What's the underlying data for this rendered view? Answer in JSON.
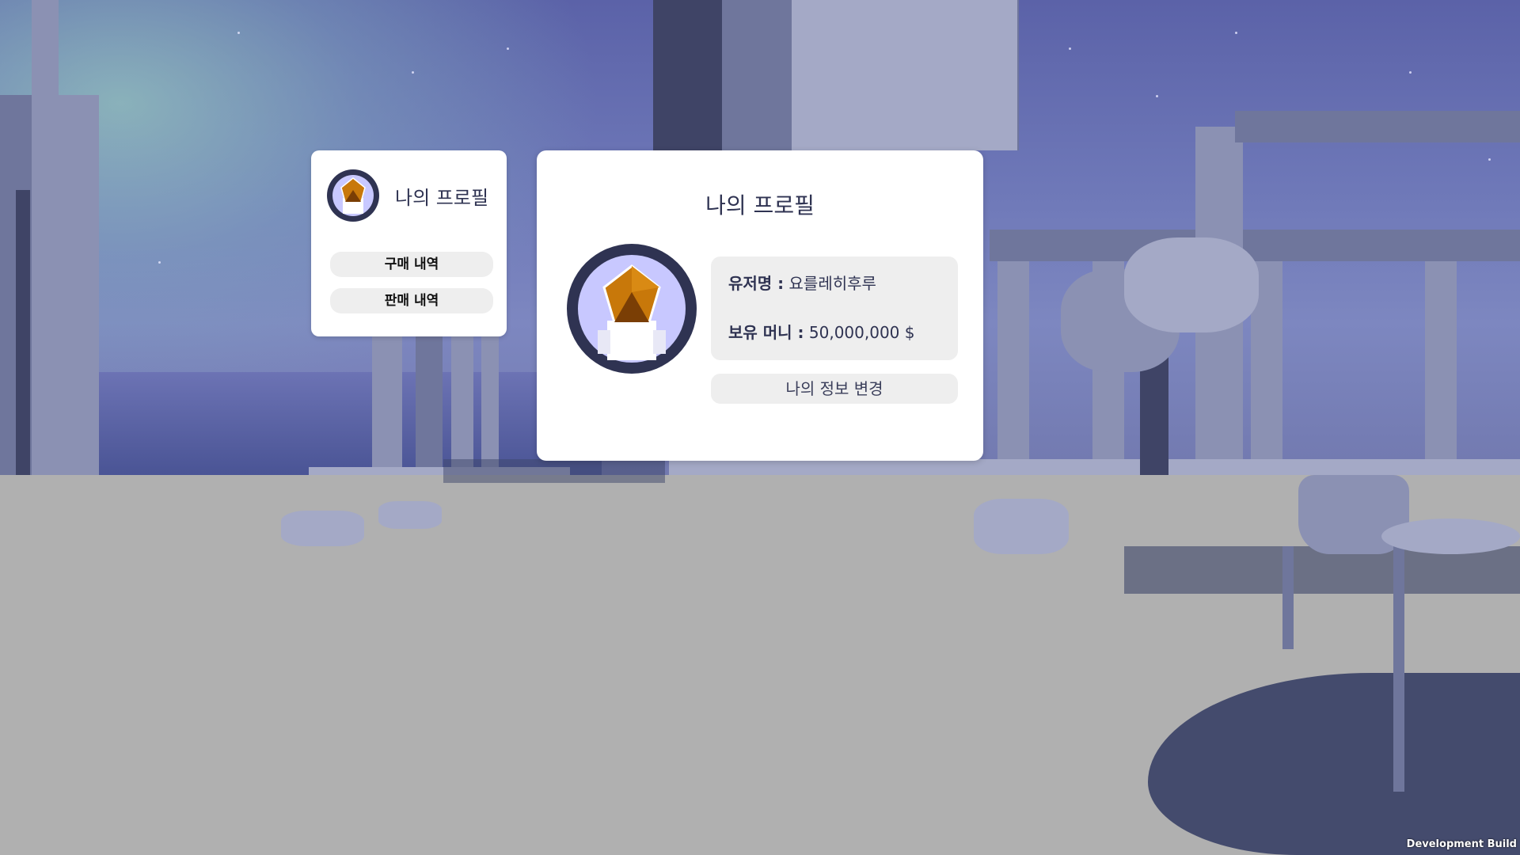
{
  "side_panel": {
    "title": "나의 프로필",
    "buttons": [
      {
        "label": "구매 내역"
      },
      {
        "label": "판매 내역"
      }
    ]
  },
  "profile_panel": {
    "title": "나의 프로필",
    "username_label": "유저명 :",
    "username_value": "요를레히후루",
    "money_label": "보유 머니 :",
    "money_value": "50,000,000 $",
    "edit_button_label": "나의 정보 변경"
  },
  "footer": {
    "build_label": "Development Build"
  },
  "colors": {
    "avatar_ring": "#2f3352",
    "avatar_bg": "#c8c8ff",
    "pentagon": "#c8780a",
    "panel_text": "#2f3352"
  },
  "icons": {
    "avatar": "pentagon-avatar-icon"
  }
}
